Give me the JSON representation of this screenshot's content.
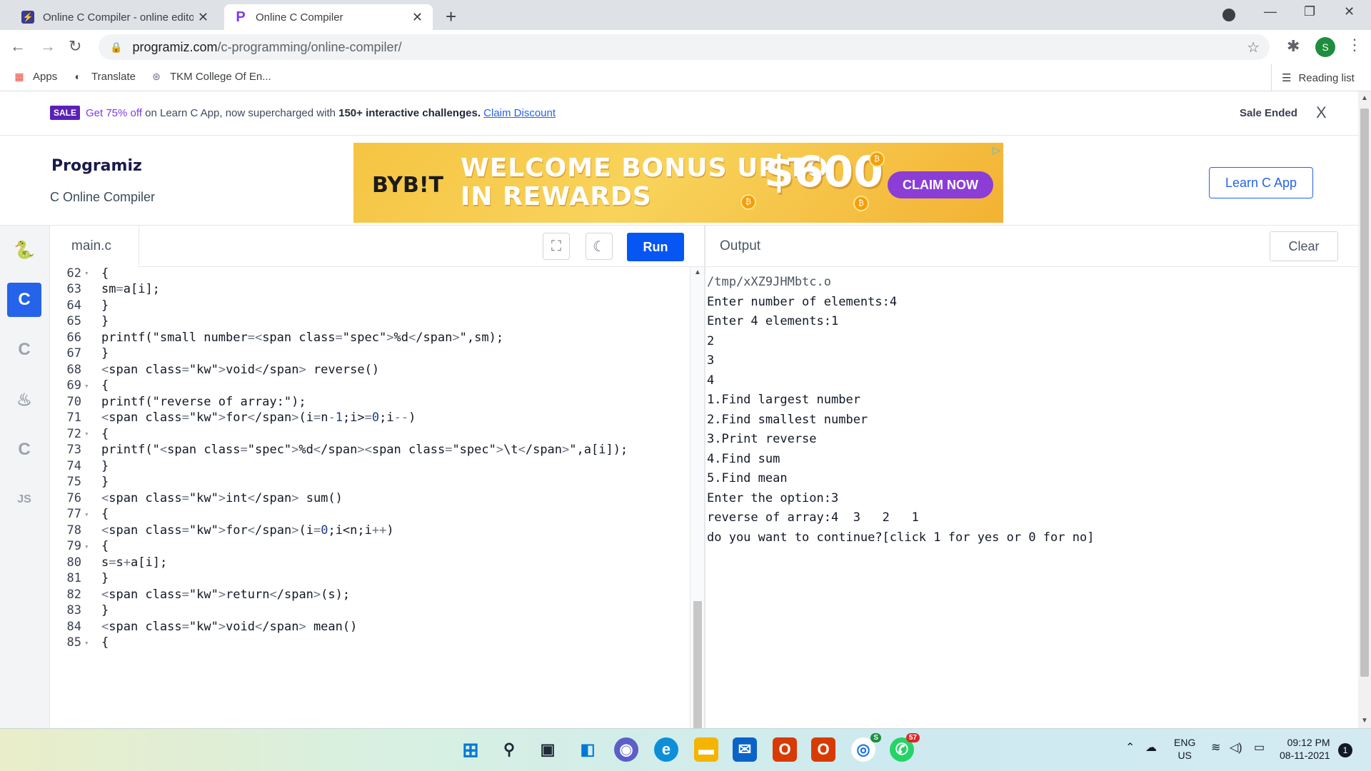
{
  "browser": {
    "tabs": [
      {
        "title": "Online C Compiler - online editor",
        "active": false
      },
      {
        "title": "Online C Compiler",
        "active": true
      }
    ],
    "url_host": "programiz.com",
    "url_path": "/c-programming/online-compiler/",
    "profile_initial": "S",
    "bookmarks": [
      "Apps",
      "Translate",
      "TKM College Of En..."
    ],
    "reading_list": "Reading list"
  },
  "promo": {
    "badge": "SALE",
    "offer": "Get 75% off",
    "text_middle": " on Learn C App, now supercharged with ",
    "text_bold": "150+ interactive challenges.",
    "link": "Claim Discount",
    "status": "Sale Ended",
    "close": "X"
  },
  "header": {
    "logo": "Programiz",
    "subtitle": "C Online Compiler",
    "learn_button": "Learn C App"
  },
  "ad": {
    "brand": "BYB!T",
    "headline_1": "WELCOME BONUS UP TO",
    "headline_2": "IN REWARDS",
    "amount": "$600",
    "cta": "CLAIM NOW"
  },
  "languages": [
    "python",
    "c",
    "cpp",
    "java",
    "csharp",
    "JS"
  ],
  "editor": {
    "filename": "main.c",
    "run_label": "Run",
    "lines": [
      {
        "n": "62",
        "fold": true,
        "html": "{"
      },
      {
        "n": "63",
        "fold": false,
        "html": "sm=a[i];"
      },
      {
        "n": "64",
        "fold": false,
        "html": "}"
      },
      {
        "n": "65",
        "fold": false,
        "html": "}"
      },
      {
        "n": "66",
        "fold": false,
        "html": "printf(\"small number=%d\",sm);"
      },
      {
        "n": "67",
        "fold": false,
        "html": "}"
      },
      {
        "n": "68",
        "fold": false,
        "html": "void reverse()"
      },
      {
        "n": "69",
        "fold": true,
        "html": "{"
      },
      {
        "n": "70",
        "fold": false,
        "html": "printf(\"reverse of array:\");"
      },
      {
        "n": "71",
        "fold": false,
        "html": "for(i=n-1;i>=0;i--)"
      },
      {
        "n": "72",
        "fold": true,
        "html": "{"
      },
      {
        "n": "73",
        "fold": false,
        "html": "printf(\"%d\\t\",a[i]);"
      },
      {
        "n": "74",
        "fold": false,
        "html": "}"
      },
      {
        "n": "75",
        "fold": false,
        "html": "}"
      },
      {
        "n": "76",
        "fold": false,
        "html": "int sum()"
      },
      {
        "n": "77",
        "fold": true,
        "html": "{"
      },
      {
        "n": "78",
        "fold": false,
        "html": "for(i=0;i<n;i++)"
      },
      {
        "n": "79",
        "fold": true,
        "html": "{"
      },
      {
        "n": "80",
        "fold": false,
        "html": "s=s+a[i];"
      },
      {
        "n": "81",
        "fold": false,
        "html": "}"
      },
      {
        "n": "82",
        "fold": false,
        "html": "return(s);"
      },
      {
        "n": "83",
        "fold": false,
        "html": "}"
      },
      {
        "n": "84",
        "fold": false,
        "html": "void mean()"
      },
      {
        "n": "85",
        "fold": true,
        "html": "{"
      }
    ]
  },
  "output": {
    "title": "Output",
    "clear_label": "Clear",
    "lines": [
      "/tmp/xXZ9JHMbtc.o",
      "Enter number of elements:4",
      "Enter 4 elements:1",
      "2",
      "3",
      "4",
      "1.Find largest number",
      "2.Find smallest number",
      "3.Print reverse",
      "4.Find sum",
      "5.Find mean",
      "Enter the option:3",
      "reverse of array:4  3   2   1",
      "do you want to continue?[click 1 for yes or 0 for no]"
    ]
  },
  "taskbar": {
    "whatsapp_badge": "57",
    "chrome_badge": "S",
    "lang": "ENG",
    "region": "US",
    "time": "09:12 PM",
    "date": "08-11-2021",
    "notifications": "1"
  }
}
